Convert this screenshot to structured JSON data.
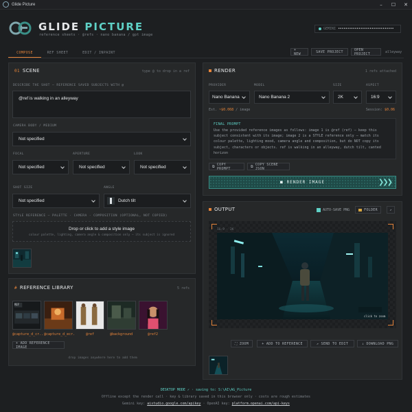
{
  "window": {
    "title": "Glide Picture",
    "minimize": "–",
    "maximize": "☐",
    "close": "✕"
  },
  "brand": {
    "title_main": "GLIDE",
    "title_accent": "PICTURE",
    "subtitle": "reference sheets · @refs · nano banana / gpt image"
  },
  "api_key": {
    "label": "GEMINI",
    "value": "••••••••••••••••••••••••••••••"
  },
  "tabs": [
    {
      "label": "COMPOSE",
      "active": true
    },
    {
      "label": "REF SHEET",
      "active": false
    },
    {
      "label": "EDIT / INPAINT",
      "active": false
    }
  ],
  "top_actions": {
    "new": "+ NEW",
    "save": "SAVE PROJECT",
    "open": "OPEN PROJECT",
    "session_name": "alleyway"
  },
  "scene": {
    "number": "01",
    "title": "SCENE",
    "hint": "type @ to drop in a ref",
    "describe_label": "DESCRIBE THE SHOT — REFERENCE SAVED SUBJECTS WITH @",
    "describe_value": "@ref is walking in an alleyway",
    "camera_label": "CAMERA BODY / MEDIUM",
    "camera_value": "Not specified",
    "focal_label": "FOCAL",
    "focal_value": "Not specified",
    "aperture_label": "APERTURE",
    "aperture_value": "Not specified",
    "look_label": "LOOK",
    "look_value": "Not specified",
    "shot_label": "SHOT SIZE",
    "shot_value": "Not specified",
    "angle_label": "ANGLE",
    "angle_value": "Dutch tilt",
    "style_label": "STYLE REFERENCE — PALETTE · CAMERA · COMPOSITION (OPTIONAL, NOT COPIED)",
    "style_drop_title": "Drop or click to add a style image",
    "style_drop_sub": "colour palette, lighting, camera angle & composition only — its subject is ignored"
  },
  "library": {
    "number": "#",
    "title": "REFERENCE LIBRARY",
    "count": "5 refs",
    "items": [
      {
        "label": "@capture_d_cr..."
      },
      {
        "label": "@capture_d_ecr..."
      },
      {
        "label": "@ref"
      },
      {
        "label": "@background"
      },
      {
        "label": "@ref2"
      }
    ],
    "ref_tag": "REF",
    "add_button": "+ ADD REFERENCE IMAGE",
    "drop_hint": "drop images anywhere here to add them"
  },
  "render": {
    "title": "RENDER",
    "refs_attached": "1 refs attached",
    "provider_label": "PROVIDER",
    "provider_value": "Nano Banana",
    "model_label": "MODEL",
    "model_value": "Nano Banana 2",
    "size_label": "SIZE",
    "size_value": "2K",
    "aspect_label": "ASPECT",
    "aspect_value": "16:9",
    "est_prefix": "Est.",
    "est_value": "~$0.068",
    "est_suffix": "/ image",
    "session_prefix": "Session:",
    "session_value": "$0.06",
    "prompt_heading": "FINAL PROMPT",
    "prompt_text": "Use the provided reference images as follows: image 1 is @ref (ref) — keep this subject consistent with its image; image 2 is a STYLE reference only — match its colour palette, lighting mood, camera angle and composition, but do NOT copy its subject, characters or objects. ref is walking in an alleyway, dutch tilt, canted horizon",
    "copy_prompt": "COPY PROMPT",
    "copy_json": "COPY SCENE JSON",
    "render_button": "RENDER IMAGE",
    "render_arrows": "❯❯❯"
  },
  "output": {
    "title": "OUTPUT",
    "autosave_label": "AUTO-SAVE PNG",
    "autosave_checked": true,
    "folder_button": "FOLDER",
    "open_button": "↗",
    "image_tag": "16:9 · 2K",
    "click_zoom": "click to zoom",
    "zoom": "ZOOM",
    "add_ref": "+ ADD TO REFERENCE",
    "send_edit": "↗ SEND TO EDIT",
    "download": "↓ DOWNLOAD PNG"
  },
  "footer": {
    "mode": "DESKTOP MODE ✓ · saving to: S:\\AI\\AG_Picture",
    "note": "Offline except the render call · key & library saved in this browser only · costs are rough estimates",
    "gemini_prefix": "Gemini key:",
    "gemini_link": "aistudio.google.com/apikey",
    "openai_prefix": "· OpenAI key:",
    "openai_link": "platform.openai.com/api-keys"
  },
  "colors": {
    "accent_orange": "#e6843a",
    "accent_teal": "#5fd1c6",
    "panel": "#262829",
    "background": "#1d1f21"
  }
}
